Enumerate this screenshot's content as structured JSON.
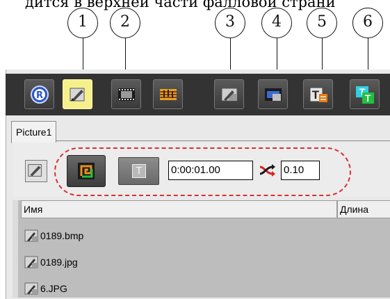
{
  "caption": "дится в верхней части фалловой страни",
  "callouts": [
    "1",
    "2",
    "3",
    "4",
    "5",
    "6"
  ],
  "toolbar": {
    "buttons": [
      {
        "name": "registered",
        "icon": "registered-icon"
      },
      {
        "name": "picture-edit",
        "icon": "picture-edit-icon",
        "active": true
      },
      {
        "name": "film",
        "icon": "film-icon"
      },
      {
        "name": "sound",
        "icon": "sound-icon"
      },
      {
        "name": "picture-effect",
        "icon": "picture-effect-icon"
      },
      {
        "name": "film-effect",
        "icon": "film-effect-icon"
      },
      {
        "name": "text",
        "icon": "text-icon"
      },
      {
        "name": "text-effect",
        "icon": "text-effect-icon"
      }
    ]
  },
  "tab": {
    "label": "Picture1"
  },
  "panel": {
    "duration": "0:00:01.00",
    "transition_value": "0.10",
    "text_button_glyph": "T"
  },
  "list": {
    "columns": [
      "Имя",
      "Длина"
    ],
    "rows": [
      "0189.bmp",
      "0189.jpg",
      "6.JPG"
    ]
  },
  "colors": {
    "toolbar_bg": "#333333",
    "active_button": "#f5f08c",
    "dashed_outline": "#d63030"
  }
}
